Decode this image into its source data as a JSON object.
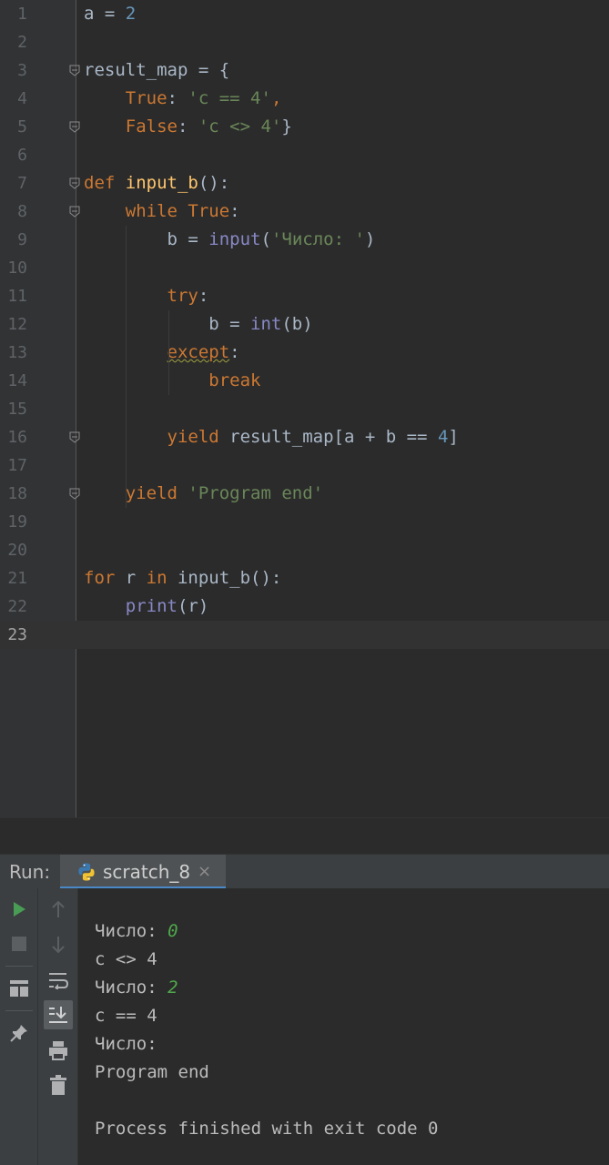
{
  "editor": {
    "lines": [
      {
        "n": "1",
        "tokens": [
          {
            "t": "a = ",
            "c": "plain"
          },
          {
            "t": "2",
            "c": "num"
          }
        ]
      },
      {
        "n": "2",
        "tokens": []
      },
      {
        "n": "3",
        "tokens": [
          {
            "t": "result_map = {",
            "c": "plain"
          }
        ]
      },
      {
        "n": "4",
        "tokens": [
          {
            "t": "    ",
            "c": "plain"
          },
          {
            "t": "True",
            "c": "kw"
          },
          {
            "t": ": ",
            "c": "plain"
          },
          {
            "t": "'c == 4'",
            "c": "str"
          },
          {
            "t": ",",
            "c": "kw"
          }
        ]
      },
      {
        "n": "5",
        "tokens": [
          {
            "t": "    ",
            "c": "plain"
          },
          {
            "t": "False",
            "c": "kw"
          },
          {
            "t": ": ",
            "c": "plain"
          },
          {
            "t": "'c <> 4'",
            "c": "str"
          },
          {
            "t": "}",
            "c": "plain"
          }
        ]
      },
      {
        "n": "6",
        "tokens": []
      },
      {
        "n": "7",
        "tokens": [
          {
            "t": "def ",
            "c": "kw"
          },
          {
            "t": "input_b",
            "c": "fn"
          },
          {
            "t": "():",
            "c": "plain"
          }
        ]
      },
      {
        "n": "8",
        "tokens": [
          {
            "t": "    ",
            "c": "plain"
          },
          {
            "t": "while ",
            "c": "kw"
          },
          {
            "t": "True",
            "c": "kw"
          },
          {
            "t": ":",
            "c": "plain"
          }
        ]
      },
      {
        "n": "9",
        "tokens": [
          {
            "t": "        b = ",
            "c": "plain"
          },
          {
            "t": "input",
            "c": "bi"
          },
          {
            "t": "(",
            "c": "plain"
          },
          {
            "t": "'Число: '",
            "c": "str"
          },
          {
            "t": ")",
            "c": "plain"
          }
        ]
      },
      {
        "n": "10",
        "tokens": []
      },
      {
        "n": "11",
        "tokens": [
          {
            "t": "        ",
            "c": "plain"
          },
          {
            "t": "try",
            "c": "kw"
          },
          {
            "t": ":",
            "c": "plain"
          }
        ]
      },
      {
        "n": "12",
        "tokens": [
          {
            "t": "            b = ",
            "c": "plain"
          },
          {
            "t": "int",
            "c": "bi"
          },
          {
            "t": "(b)",
            "c": "plain"
          }
        ]
      },
      {
        "n": "13",
        "tokens": [
          {
            "t": "        ",
            "c": "plain"
          },
          {
            "t": "except",
            "c": "kw squig"
          },
          {
            "t": ":",
            "c": "plain"
          }
        ]
      },
      {
        "n": "14",
        "tokens": [
          {
            "t": "            ",
            "c": "plain"
          },
          {
            "t": "break",
            "c": "kw"
          }
        ]
      },
      {
        "n": "15",
        "tokens": []
      },
      {
        "n": "16",
        "tokens": [
          {
            "t": "        ",
            "c": "plain"
          },
          {
            "t": "yield ",
            "c": "kw"
          },
          {
            "t": "result_map[a + b == ",
            "c": "plain"
          },
          {
            "t": "4",
            "c": "num"
          },
          {
            "t": "]",
            "c": "plain"
          }
        ]
      },
      {
        "n": "17",
        "tokens": []
      },
      {
        "n": "18",
        "tokens": [
          {
            "t": "    ",
            "c": "plain"
          },
          {
            "t": "yield ",
            "c": "kw"
          },
          {
            "t": "'Program end'",
            "c": "str"
          }
        ]
      },
      {
        "n": "19",
        "tokens": []
      },
      {
        "n": "20",
        "tokens": []
      },
      {
        "n": "21",
        "tokens": [
          {
            "t": "for ",
            "c": "kw"
          },
          {
            "t": "r ",
            "c": "plain"
          },
          {
            "t": "in ",
            "c": "kw"
          },
          {
            "t": "input_b():",
            "c": "plain"
          }
        ]
      },
      {
        "n": "22",
        "tokens": [
          {
            "t": "    ",
            "c": "plain"
          },
          {
            "t": "print",
            "c": "bi"
          },
          {
            "t": "(r)",
            "c": "plain"
          }
        ]
      },
      {
        "n": "23",
        "tokens": []
      }
    ],
    "current_line": "23",
    "fold_lines": [
      "3",
      "5",
      "7",
      "8",
      "16",
      "18"
    ]
  },
  "run_panel": {
    "label": "Run:",
    "tab_label": "scratch_8",
    "close_glyph": "×"
  },
  "console": {
    "lines": [
      {
        "text": "Число: ",
        "input": "0"
      },
      {
        "text": "c <> 4",
        "input": ""
      },
      {
        "text": "Число: ",
        "input": "2"
      },
      {
        "text": "c == 4",
        "input": ""
      },
      {
        "text": "Число: ",
        "input": ""
      },
      {
        "text": "Program end",
        "input": ""
      },
      {
        "text": "",
        "input": ""
      },
      {
        "text": "Process finished with exit code 0",
        "input": ""
      }
    ]
  },
  "icons": {
    "toolbar_left": [
      "run-icon",
      "stop-icon",
      "layout-icon",
      "pin-icon"
    ],
    "toolbar_right": [
      "up-arrow-icon",
      "down-arrow-icon",
      "soft-wrap-icon",
      "scroll-to-end-icon",
      "print-icon",
      "trash-icon"
    ]
  },
  "colors": {
    "keyword": "#cc7832",
    "number": "#6897bb",
    "string": "#6a8759",
    "function": "#ffc66d",
    "builtin": "#8888c6",
    "accent": "#4a88c7",
    "run_green": "#499c54"
  }
}
